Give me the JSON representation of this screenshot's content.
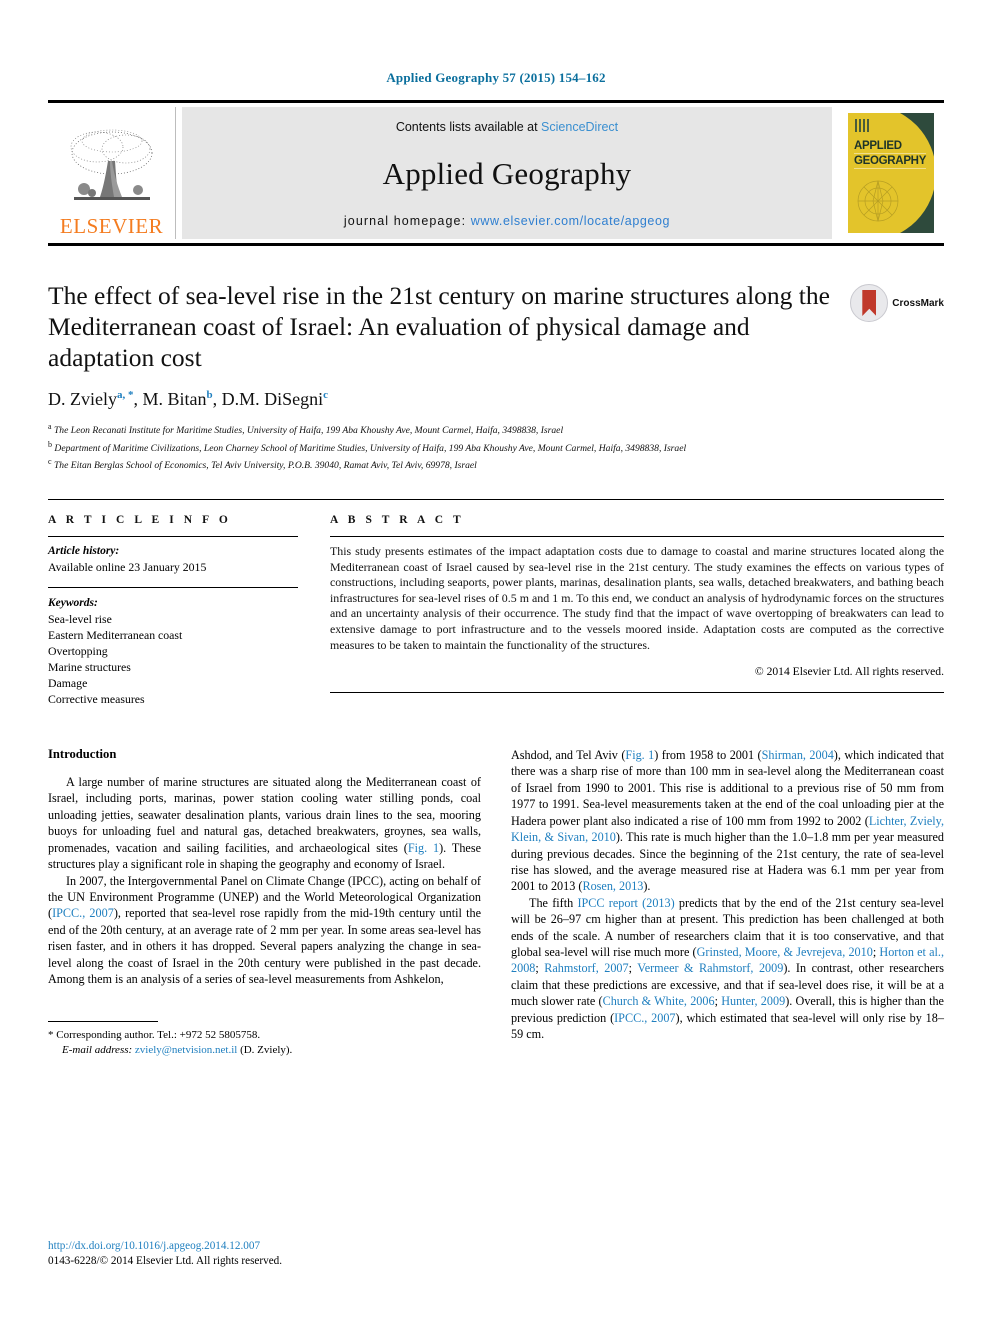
{
  "running_head": "Applied Geography 57 (2015) 154–162",
  "masthead": {
    "publisher_name": "ELSEVIER",
    "contents_prefix": "Contents lists available at ",
    "contents_link": "ScienceDirect",
    "journal_name": "Applied Geography",
    "homepage_prefix": "journal homepage: ",
    "homepage_url": "www.elsevier.com/locate/apgeog",
    "cover_title_line1": "APPLIED",
    "cover_title_line2": "GEOGRAPHY"
  },
  "article": {
    "title": "The effect of sea-level rise in the 21st century on marine structures along the Mediterranean coast of Israel: An evaluation of physical damage and adaptation cost",
    "crossmark_label": "CrossMark",
    "authors": [
      {
        "name": "D. Zviely",
        "marks": "a, *"
      },
      {
        "name": "M. Bitan",
        "marks": "b"
      },
      {
        "name": "D.M. DiSegni",
        "marks": "c"
      }
    ],
    "affiliations": [
      {
        "mark": "a",
        "text": "The Leon Recanati Institute for Maritime Studies, University of Haifa, 199 Aba Khoushy Ave, Mount Carmel, Haifa, 3498838, Israel"
      },
      {
        "mark": "b",
        "text": "Department of Maritime Civilizations, Leon Charney School of Maritime Studies, University of Haifa, 199 Aba Khoushy Ave, Mount Carmel, Haifa, 3498838, Israel"
      },
      {
        "mark": "c",
        "text": "The Eitan Berglas School of Economics, Tel Aviv University, P.O.B. 39040, Ramat Aviv, Tel Aviv, 69978, Israel"
      }
    ]
  },
  "article_info": {
    "heading": "A R T I C L E  I N F O",
    "history_label": "Article history:",
    "history_value": "Available online 23 January 2015",
    "keywords_label": "Keywords:",
    "keywords": [
      "Sea-level rise",
      "Eastern Mediterranean coast",
      "Overtopping",
      "Marine structures",
      "Damage",
      "Corrective measures"
    ]
  },
  "abstract": {
    "heading": "A B S T R A C T",
    "text": "This study presents estimates of the impact adaptation costs due to damage to coastal and marine structures located along the Mediterranean coast of Israel caused by sea-level rise in the 21st century. The study examines the effects on various types of constructions, including seaports, power plants, marinas, desalination plants, sea walls, detached breakwaters, and bathing beach infrastructures for sea-level rises of 0.5 m and 1 m. To this end, we conduct an analysis of hydrodynamic forces on the structures and an uncertainty analysis of their occurrence. The study find that the impact of wave overtopping of breakwaters can lead to extensive damage to port infrastructure and to the vessels moored inside. Adaptation costs are computed as the corrective measures to be taken to maintain the functionality of the structures.",
    "copyright": "© 2014 Elsevier Ltd. All rights reserved."
  },
  "body": {
    "section_heading": "Introduction",
    "left_paragraphs": [
      "A large number of marine structures are situated along the Mediterranean coast of Israel, including ports, marinas, power station cooling water stilling ponds, coal unloading jetties, seawater desalination plants, various drain lines to the sea, mooring buoys for unloading fuel and natural gas, detached breakwaters, groynes, sea walls, promenades, vacation and sailing facilities, and archaeological sites (Fig. 1). These structures play a significant role in shaping the geography and economy of Israel.",
      "In 2007, the Intergovernmental Panel on Climate Change (IPCC), acting on behalf of the UN Environment Programme (UNEP) and the World Meteorological Organization (IPCC., 2007), reported that sea-level rose rapidly from the mid-19th century until the end of the 20th century, at an average rate of 2 mm per year. In some areas sea-level has risen faster, and in others it has dropped. Several papers analyzing the change in sea-level along the coast of Israel in the 20th century were published in the past decade. Among them is an analysis of a series of sea-level measurements from Ashkelon,"
    ],
    "right_paragraphs": [
      "Ashdod, and Tel Aviv (Fig. 1) from 1958 to 2001 (Shirman, 2004), which indicated that there was a sharp rise of more than 100 mm in sea-level along the Mediterranean coast of Israel from 1990 to 2001. This rise is additional to a previous rise of 50 mm from 1977 to 1991. Sea-level measurements taken at the end of the coal unloading pier at the Hadera power plant also indicated a rise of 100 mm from 1992 to 2002 (Lichter, Zviely, Klein, & Sivan, 2010). This rate is much higher than the 1.0–1.8 mm per year measured during previous decades. Since the beginning of the 21st century, the rate of sea-level rise has slowed, and the average measured rise at Hadera was 6.1 mm per year from 2001 to 2013 (Rosen, 2013).",
      "The fifth IPCC report (2013) predicts that by the end of the 21st century sea-level will be 26–97 cm higher than at present. This prediction has been challenged at both ends of the scale. A number of researchers claim that it is too conservative, and that global sea-level will rise much more (Grinsted, Moore, & Jevrejeva, 2010; Horton et al., 2008; Rahmstorf, 2007; Vermeer & Rahmstorf, 2009). In contrast, other researchers claim that these predictions are excessive, and that if sea-level does rise, it will be at a much slower rate (Church & White, 2006; Hunter, 2009). Overall, this is higher than the previous prediction (IPCC., 2007), which estimated that sea-level will only rise by 18–59 cm."
    ]
  },
  "footnote": {
    "corresponding": "Corresponding author. Tel.: +972 52 5805758.",
    "email_label": "E-mail address:",
    "email": "zviely@netvision.net.il",
    "email_suffix": "(D. Zviely)."
  },
  "page_footer": {
    "doi": "http://dx.doi.org/10.1016/j.apgeog.2014.12.007",
    "issn_line": "0143-6228/© 2014 Elsevier Ltd. All rights reserved."
  }
}
